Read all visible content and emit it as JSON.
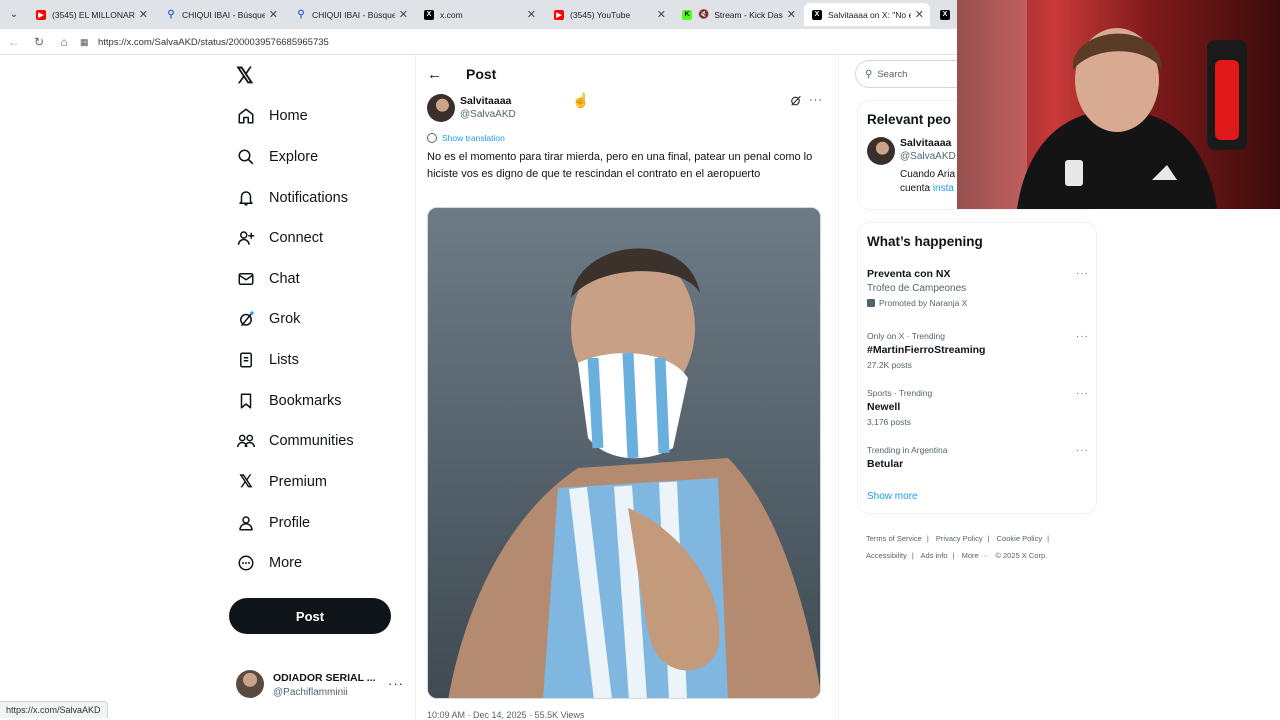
{
  "browser": {
    "tabs": [
      {
        "icon": "youtube-icon",
        "title": "(3545) EL MILLONARIO |",
        "active": false
      },
      {
        "icon": "search-icon",
        "title": "CHIQUI IBAI - Búsqueda",
        "active": false
      },
      {
        "icon": "search-icon",
        "title": "CHIQUI IBAI - Búsqueda",
        "active": false
      },
      {
        "icon": "x-logo-icon",
        "title": "x.com",
        "active": false
      },
      {
        "icon": "youtube-icon",
        "title": "(3545) YouTube",
        "active": false
      },
      {
        "icon": "kick-icon",
        "title": "Stream - Kick Dashb",
        "active": false
      },
      {
        "icon": "x-logo-icon",
        "title": "Salvitaaaa on X: \"No es",
        "active": true
      },
      {
        "icon": "x-logo-icon",
        "title": "E",
        "active": false
      }
    ],
    "url": "https://x.com/SalvaAKD/status/2000039576685965735",
    "status_url": "https://x.com/SalvaAKD"
  },
  "nav": {
    "items": [
      {
        "icon": "home-icon",
        "label": "Home"
      },
      {
        "icon": "explore-icon",
        "label": "Explore"
      },
      {
        "icon": "bell-icon",
        "label": "Notifications"
      },
      {
        "icon": "connect-icon",
        "label": "Connect"
      },
      {
        "icon": "chat-icon",
        "label": "Chat"
      },
      {
        "icon": "grok-icon",
        "label": "Grok"
      },
      {
        "icon": "lists-icon",
        "label": "Lists"
      },
      {
        "icon": "bookmark-icon",
        "label": "Bookmarks"
      },
      {
        "icon": "communities-icon",
        "label": "Communities"
      },
      {
        "icon": "x-logo-icon",
        "label": "Premium"
      },
      {
        "icon": "profile-icon",
        "label": "Profile"
      },
      {
        "icon": "more-circle-icon",
        "label": "More"
      }
    ],
    "post_button": "Post",
    "account": {
      "name": "ODIADOR SERIAL ...",
      "handle": "@Pachiflamminii"
    }
  },
  "main": {
    "title": "Post",
    "author": {
      "name": "Salvitaaaa",
      "handle": "@SalvaAKD"
    },
    "translate": "Show translation",
    "text": "No es el momento para tirar mierda, pero en una final, patear un penal como lo hiciste vos es digno de que te rescindan el contrato en el aeropuerto",
    "meta": "10:09 AM · Dec 14, 2025 · 55.5K Views"
  },
  "sidebar": {
    "search_placeholder": "Search",
    "relevant": {
      "title": "Relevant peo",
      "name": "Salvitaaaa",
      "handle": "@SalvaAKD",
      "bio": "Cuando Aria",
      "bio2": "cuenta",
      "bio_link": "insta"
    },
    "happening": {
      "title": "What’s happening",
      "trends": [
        {
          "context": "",
          "name": "Preventa con NX",
          "sub": "Trofeo de Campeones",
          "promo": "Promoted by Naranja X",
          "posts": ""
        },
        {
          "context": "Only on X · Trending",
          "name": "#MartinFierroStreaming",
          "sub": "",
          "promo": "",
          "posts": "27.2K posts"
        },
        {
          "context": "Sports · Trending",
          "name": "Newell",
          "sub": "",
          "promo": "",
          "posts": "3,176 posts"
        },
        {
          "context": "Trending in Argentina",
          "name": "Betular",
          "sub": "",
          "promo": "",
          "posts": ""
        }
      ],
      "show_more": "Show more"
    },
    "footer": [
      "Terms of Service",
      "|",
      "Privacy Policy",
      "|",
      "Cookie Policy",
      "|",
      "Accessibility",
      "|",
      "Ads info",
      "|",
      "More ···",
      "© 2025 X Corp."
    ]
  }
}
